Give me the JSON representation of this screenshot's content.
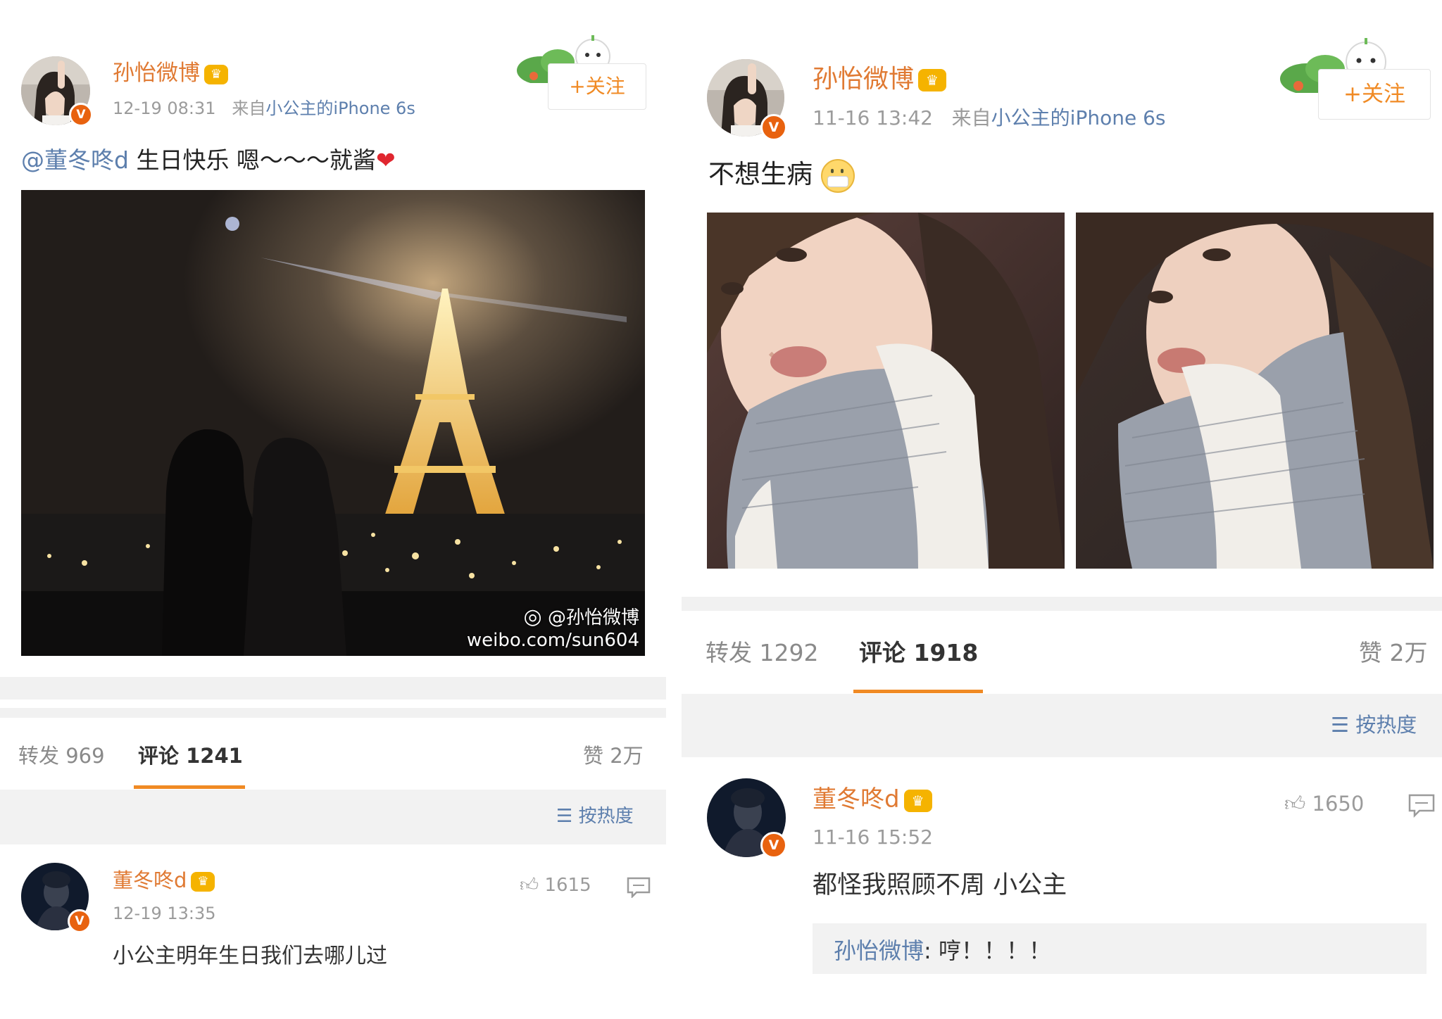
{
  "left": {
    "post": {
      "author": "孙怡微博",
      "verified_badge": "V",
      "timestamp": "12-19 08:31",
      "source_prefix": "来自",
      "source_device": "小公主的iPhone 6s",
      "follow_label": "+关注",
      "mention": "@董冬咚d",
      "text": " 生日快乐  嗯～～～就酱",
      "photo_watermark_handle": "@孙怡微博",
      "photo_watermark_url": "weibo.com/sun604"
    },
    "tabs": {
      "repost_label": "转发",
      "repost_count": "969",
      "comment_label": "评论",
      "comment_count": "1241",
      "like_label": "赞",
      "like_count": "2万"
    },
    "sort_label": "按热度",
    "comment": {
      "author": "董冬咚d",
      "verified_badge": "V",
      "likes": "1615",
      "timestamp": "12-19 13:35",
      "text": "小公主明年生日我们去哪儿过"
    }
  },
  "right": {
    "post": {
      "author": "孙怡微博",
      "verified_badge": "V",
      "timestamp": "11-16 13:42",
      "source_prefix": "来自",
      "source_device": "小公主的iPhone 6s",
      "follow_label": "+关注",
      "text": "不想生病"
    },
    "tabs": {
      "repost_label": "转发",
      "repost_count": "1292",
      "comment_label": "评论",
      "comment_count": "1918",
      "like_label": "赞",
      "like_count": "2万"
    },
    "sort_label": "按热度",
    "comment": {
      "author": "董冬咚d",
      "verified_badge": "V",
      "likes": "1650",
      "timestamp": "11-16 15:52",
      "text": "都怪我照顾不周 小公主",
      "reply_author": "孙怡微博",
      "reply_sep": ": ",
      "reply_text": "哼！！！！"
    }
  },
  "colors": {
    "accent": "#f08a24",
    "username": "#e07a33",
    "link": "#5d7fad",
    "verified": "#e8620f"
  },
  "icons": [
    "crown-icon",
    "heart-icon",
    "mask-emoji-icon",
    "weibo-logo-icon",
    "thumbs-up-icon",
    "comment-icon",
    "sort-icon",
    "verified-badge-icon"
  ]
}
